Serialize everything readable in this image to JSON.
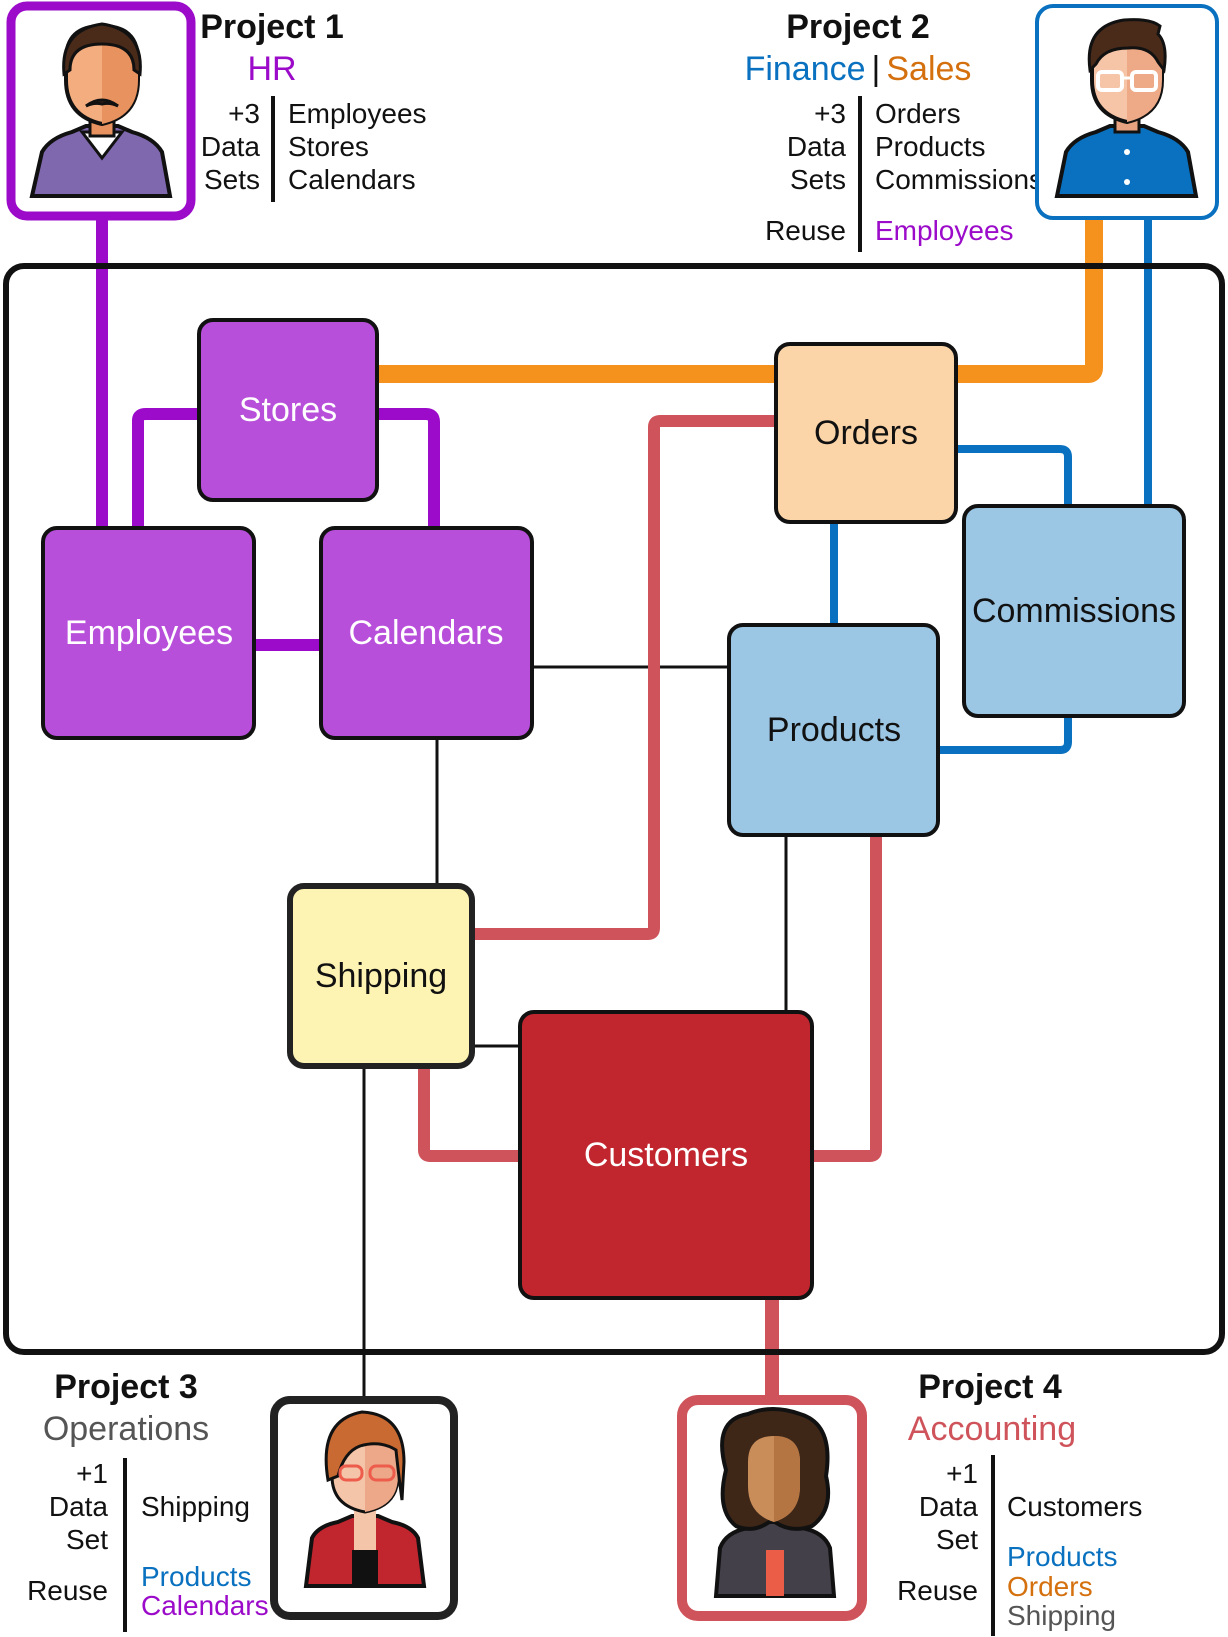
{
  "colors": {
    "purple": "#9b0bc9",
    "purple_fill": "#b84fda",
    "orange": "#f5921e",
    "orange_text": "#d4700e",
    "orange_fill": "#fbd5a8",
    "blue": "#0971bf",
    "blue_fill": "#9bc6e4",
    "red_line": "#cf535a",
    "red_fill": "#c1262f",
    "yellow_fill": "#fdf4b3",
    "gray_text": "#555555",
    "black": "#111111"
  },
  "nodes": [
    {
      "id": "stores",
      "label": "Stores",
      "fill": "#b84fda",
      "text": "#ffffff"
    },
    {
      "id": "employees",
      "label": "Employees",
      "fill": "#b84fda",
      "text": "#ffffff"
    },
    {
      "id": "calendars",
      "label": "Calendars",
      "fill": "#b84fda",
      "text": "#ffffff"
    },
    {
      "id": "orders",
      "label": "Orders",
      "fill": "#fbd5a8",
      "text": "#111111"
    },
    {
      "id": "commissions",
      "label": "Commissions",
      "fill": "#9bc6e4",
      "text": "#111111"
    },
    {
      "id": "products",
      "label": "Products",
      "fill": "#9bc6e4",
      "text": "#111111"
    },
    {
      "id": "shipping",
      "label": "Shipping",
      "fill": "#fdf4b3",
      "text": "#111111"
    },
    {
      "id": "customers",
      "label": "Customers",
      "fill": "#c1262f",
      "text": "#ffffff"
    }
  ],
  "edges": [
    {
      "from": "project1",
      "to": "employees",
      "color": "purple"
    },
    {
      "from": "employees",
      "to": "stores",
      "color": "purple"
    },
    {
      "from": "stores",
      "to": "calendars",
      "color": "purple"
    },
    {
      "from": "employees",
      "to": "calendars",
      "color": "purple"
    },
    {
      "from": "stores",
      "to": "project2",
      "color": "orange"
    },
    {
      "from": "orders",
      "to": "commissions",
      "color": "blue"
    },
    {
      "from": "orders",
      "to": "products",
      "color": "blue"
    },
    {
      "from": "products",
      "to": "commissions",
      "color": "blue"
    },
    {
      "from": "commissions",
      "to": "project2",
      "color": "blue"
    },
    {
      "from": "calendars",
      "to": "products",
      "color": "black"
    },
    {
      "from": "calendars",
      "to": "shipping",
      "color": "black"
    },
    {
      "from": "shipping",
      "to": "customers",
      "color": "black"
    },
    {
      "from": "products",
      "to": "customers",
      "color": "black"
    },
    {
      "from": "shipping",
      "to": "project3",
      "color": "black"
    },
    {
      "from": "shipping",
      "to": "orders",
      "color": "red"
    },
    {
      "from": "shipping",
      "to": "customers",
      "color": "red"
    },
    {
      "from": "products",
      "to": "customers",
      "color": "red"
    },
    {
      "from": "customers",
      "to": "project4",
      "color": "red"
    }
  ],
  "projects": {
    "p1": {
      "title": "Project 1",
      "dept": "HR",
      "avatar": "man-mustache-avatar",
      "count_label": [
        "+3",
        "Data",
        "Sets"
      ],
      "datasets": [
        "Employees",
        "Stores",
        "Calendars"
      ]
    },
    "p2": {
      "title": "Project 2",
      "dept_a": "Finance",
      "dept_sep": "|",
      "dept_b": "Sales",
      "avatar": "man-glasses-avatar",
      "count_label": [
        "+3",
        "Data",
        "Sets"
      ],
      "datasets": [
        "Orders",
        "Products",
        "Commissions"
      ],
      "reuse_label": "Reuse",
      "reuse": [
        "Employees"
      ]
    },
    "p3": {
      "title": "Project 3",
      "dept": "Operations",
      "avatar": "woman-glasses-avatar",
      "count_label": [
        "+1",
        "Data",
        "Set"
      ],
      "datasets": [
        "Shipping"
      ],
      "reuse_label": "Reuse",
      "reuse": [
        "Products",
        "Calendars"
      ]
    },
    "p4": {
      "title": "Project 4",
      "dept": "Accounting",
      "avatar": "woman-curly-hair-avatar",
      "count_label": [
        "+1",
        "Data",
        "Set"
      ],
      "datasets": [
        "Customers"
      ],
      "reuse_label": "Reuse",
      "reuse": [
        "Products",
        "Orders",
        "Shipping"
      ]
    }
  }
}
